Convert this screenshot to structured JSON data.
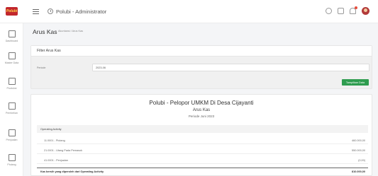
{
  "topbar": {
    "logo_text": "Polubi",
    "title": "Polubi - Administrator",
    "icons": [
      "settings-icon",
      "fullscreen-icon",
      "notification-bell-icon",
      "avatar"
    ]
  },
  "sidebar": {
    "items": [
      {
        "label": "Dashboard",
        "icon": "dashboard-icon"
      },
      {
        "label": "Master Data",
        "icon": "master-data-icon"
      },
      {
        "label": "Produksi",
        "icon": "production-icon"
      },
      {
        "label": "Pembelian",
        "icon": "purchase-icon"
      },
      {
        "label": "Penjualan",
        "icon": "cart-icon"
      },
      {
        "label": "Piutang",
        "icon": "receivable-icon"
      }
    ]
  },
  "page": {
    "title": "Arus Kas",
    "breadcrumb": "Akuntansi / Arus Kas"
  },
  "filter": {
    "title": "Filter Arus Kas",
    "period_label": "Periode",
    "period_value": "2023-06",
    "show_button": "Tampilkan Data"
  },
  "report": {
    "title": "Polubi - Pelopor UMKM Di Desa Cijayanti",
    "subtitle": "Arus Kas",
    "period": "Periode Juni 2023",
    "section": "Operating Activity",
    "rows": [
      {
        "label": "11.0001 - Piutang",
        "value": "460.000,00"
      },
      {
        "label": "21.0001 - Utang Pada Pemasok",
        "value": "550.000,00"
      },
      {
        "label": "41.0001 - Penjualan",
        "value": "(0,00)"
      }
    ],
    "total": {
      "label": "Kas bersih yang diperoleh dari Operating Activity",
      "value": "810.000,00"
    }
  },
  "colors": {
    "accent_green": "#2e9c4f",
    "logo_red": "#c2272d"
  }
}
